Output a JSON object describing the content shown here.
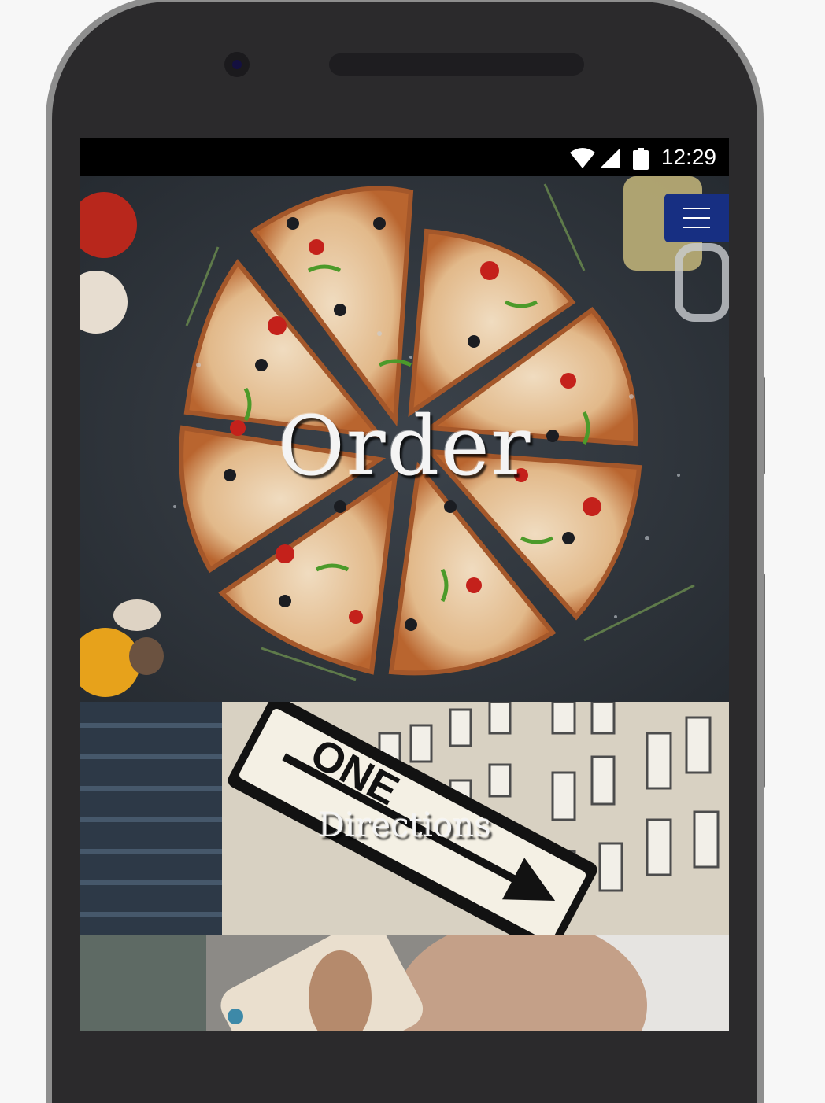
{
  "status_bar": {
    "time": "12:29",
    "icons": [
      "wifi-icon",
      "cell-signal-icon",
      "battery-icon"
    ]
  },
  "header": {
    "menu_icon": "hamburger-menu-icon",
    "menu_color": "#172f82"
  },
  "tiles": [
    {
      "title": "Order",
      "image": "pizza-photo"
    },
    {
      "title": "Directions",
      "image": "one-way-sign-photo"
    },
    {
      "title": "",
      "image": "phone-call-photo"
    }
  ],
  "colors": {
    "accent": "#172f82",
    "frame": "#2b2a2c"
  }
}
